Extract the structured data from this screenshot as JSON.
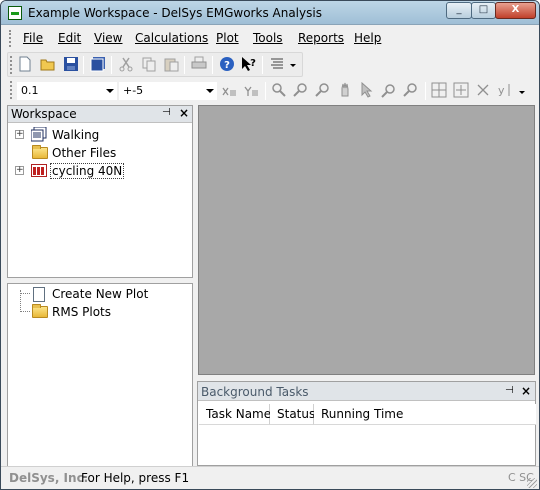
{
  "window": {
    "title": "Example Workspace - DelSys EMGworks Analysis",
    "minimize": "_",
    "maximize": "□",
    "close": "X"
  },
  "menu": [
    "File",
    "Edit",
    "View",
    "Calculations",
    "Plot",
    "Tools",
    "Reports",
    "Help"
  ],
  "toolbar2": {
    "combo1": "0.1",
    "combo2": "+-5"
  },
  "workspace": {
    "title": "Workspace",
    "pin": "📌",
    "close": "×",
    "items": [
      {
        "label": "Walking",
        "expander": "+"
      },
      {
        "label": "Other Files"
      },
      {
        "label": "cycling 40N",
        "expander": "+"
      }
    ]
  },
  "plots": {
    "items": [
      {
        "label": "Create New Plot"
      },
      {
        "label": "RMS Plots"
      }
    ]
  },
  "background_tasks": {
    "title": "Background Tasks",
    "pin": "📌",
    "close": "×",
    "columns": [
      "Task Name",
      "Status",
      "Running Time"
    ]
  },
  "status": {
    "left": "DelSys, Inc.",
    "message": "For Help, press F1",
    "right": "C SC"
  },
  "colors": {
    "title_bar": "#bdd6e6",
    "gray_area": "#a8a8a8",
    "close_red": "#c0402a"
  }
}
